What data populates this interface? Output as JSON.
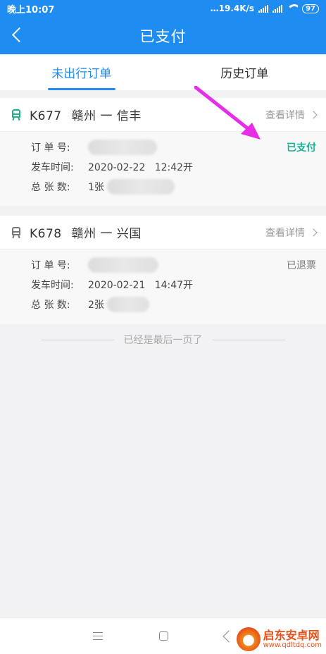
{
  "status_bar": {
    "time": "晚上10:07",
    "net_speed": "19.4K/s",
    "battery": "97"
  },
  "nav": {
    "title": "已支付"
  },
  "tabs": [
    {
      "label": "未出行订单",
      "active": true
    },
    {
      "label": "历史订单",
      "active": false
    }
  ],
  "orders": [
    {
      "train": "K677",
      "route": "赣州 一 信丰",
      "detail_label": "查看详情",
      "status": "已支付",
      "order_no_label": "订 单 号:",
      "departure_label": "发车时间:",
      "departure_time": "2020-02-22   12:42开",
      "count_label": "总 张 数:",
      "count": "1张"
    },
    {
      "train": "K678",
      "route": "赣州 一 兴国",
      "detail_label": "查看详情",
      "status": "已退票",
      "order_no_label": "订 单 号:",
      "departure_label": "发车时间:",
      "departure_time": "2020-02-21   14:47开",
      "count_label": "总 张 数:",
      "count": "2张"
    }
  ],
  "end_text": "已经是最后一页了",
  "watermark": {
    "title": "启东安卓网",
    "url": "www.qdltdq.com"
  },
  "colors": {
    "accent": "#1e8cf0",
    "paid": "#1ab394",
    "arrow": "#e62ee6"
  }
}
